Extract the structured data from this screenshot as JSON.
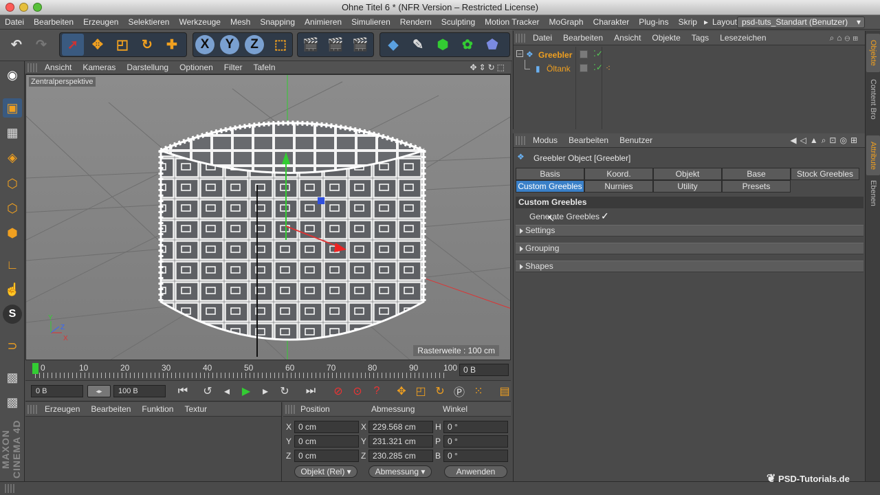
{
  "window": {
    "title": "Ohne Titel 6 * (NFR Version – Restricted License)",
    "lights": [
      "#fc5b57",
      "#e5bf3c",
      "#57c038"
    ]
  },
  "menu": {
    "items": [
      "Datei",
      "Bearbeiten",
      "Erzeugen",
      "Selektieren",
      "Werkzeuge",
      "Mesh",
      "Snapping",
      "Animieren",
      "Simulieren",
      "Rendern",
      "Sculpting",
      "Motion Tracker",
      "MoGraph",
      "Charakter",
      "Plug-ins",
      "Skrip"
    ],
    "layout_label": "Layout:",
    "layout_value": "psd-tuts_Standart (Benutzer)"
  },
  "toolbar": {
    "axis_x": "X",
    "axis_y": "Y",
    "axis_z": "Z",
    "icons": [
      "undo-icon",
      "redo-icon",
      "select-icon",
      "move-icon",
      "scale-icon",
      "rotate-icon",
      "crosshair-icon",
      "axis-x-icon",
      "axis-y-icon",
      "axis-z-icon",
      "coord-system-icon",
      "render-view-icon",
      "render-picture-icon",
      "render-settings-icon",
      "cube-icon",
      "spline-icon",
      "nurbs-icon",
      "array-icon",
      "deformer-icon",
      "scene-icon",
      "camera-icon",
      "light-icon"
    ]
  },
  "viewport": {
    "menu": [
      "Ansicht",
      "Kameras",
      "Darstellung",
      "Optionen",
      "Filter",
      "Tafeln"
    ],
    "label": "Zentralperspektive",
    "grid_info": "Rasterweite : 100 cm",
    "axis_x": "X",
    "axis_y": "Y",
    "axis_z": "Z"
  },
  "timeline": {
    "ticks": [
      "0",
      "10",
      "20",
      "30",
      "40",
      "50",
      "60",
      "70",
      "80",
      "90",
      "100"
    ],
    "frame_value": "0 B",
    "start_value": "0 B",
    "end_value": "100 B",
    "playhead": 0
  },
  "material_panel": {
    "menu": [
      "Erzeugen",
      "Bearbeiten",
      "Funktion",
      "Textur"
    ]
  },
  "coordinates": {
    "headers": [
      "Position",
      "Abmessung",
      "Winkel"
    ],
    "pos_labels": [
      "X",
      "Y",
      "Z"
    ],
    "pos_values": [
      "0 cm",
      "0 cm",
      "0 cm"
    ],
    "size_labels": [
      "X",
      "Y",
      "Z"
    ],
    "size_values": [
      "229.568 cm",
      "231.321 cm",
      "230.285 cm"
    ],
    "rot_labels": [
      "H",
      "P",
      "B"
    ],
    "rot_values": [
      "0 °",
      "0 °",
      "0 °"
    ],
    "mode_btn": "Objekt (Rel)",
    "size_btn": "Abmessung",
    "apply_btn": "Anwenden"
  },
  "object_manager": {
    "menu": [
      "Datei",
      "Bearbeiten",
      "Ansicht",
      "Objekte",
      "Tags",
      "Lesezeichen"
    ],
    "objects": [
      {
        "name": "Greebler",
        "color": "#f0a020"
      },
      {
        "name": "Öltank",
        "color": "#f0a020"
      }
    ]
  },
  "attribute_manager": {
    "menu": [
      "Modus",
      "Bearbeiten",
      "Benutzer"
    ],
    "object_title": "Greebler Object [Greebler]",
    "tabs_row1": [
      "Basis",
      "Koord.",
      "Objekt",
      "Base",
      "Stock Greebles"
    ],
    "tabs_row2": [
      "Custom Greebles",
      "Nurnies",
      "Utility",
      "Presets"
    ],
    "active_tab": "Custom Greebles",
    "section": "Custom Greebles",
    "param_label": "Generate Greebles",
    "param_checked": "✓",
    "groups": [
      "Settings",
      "Grouping",
      "Shapes"
    ]
  },
  "side_tabs": [
    "Objekte",
    "Content Bro",
    "Attribute",
    "Ebenen"
  ],
  "watermark": "PSD-Tutorials.de",
  "maxon": "MAXON CINEMA 4D",
  "colors": {
    "accent": "#f0a020",
    "active_tab": "#3a80c8",
    "axis_x": "#e03030",
    "axis_y": "#30c030",
    "axis_z": "#3050e0"
  }
}
